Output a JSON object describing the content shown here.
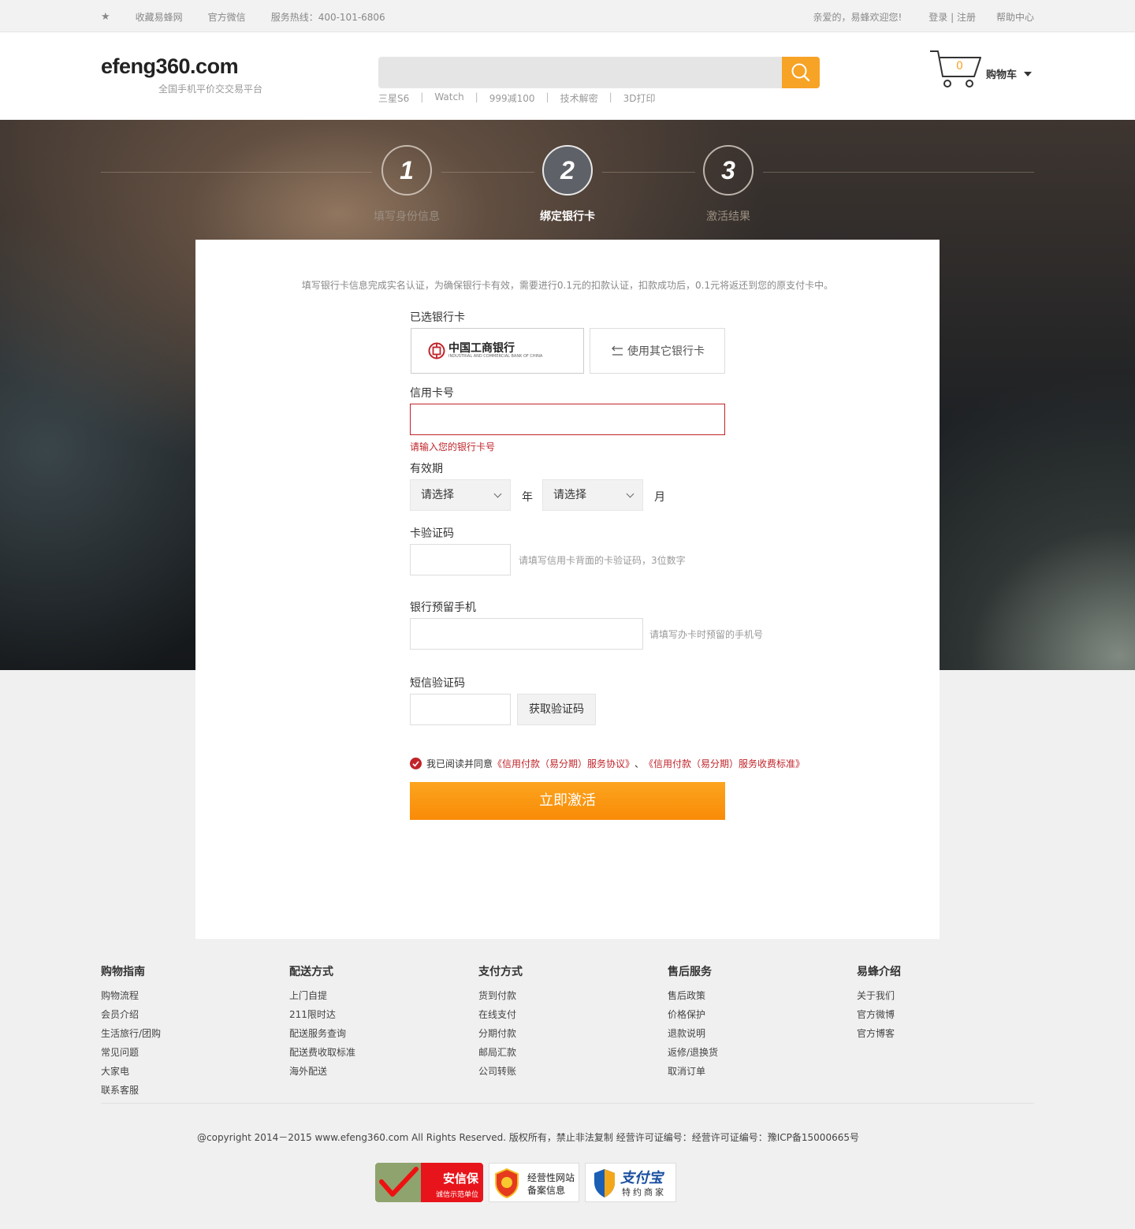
{
  "topbar": {
    "favorite": "收藏易蜂网",
    "wechat": "官方微信",
    "hotline": "服务热线：400-101-6806",
    "welcome": "亲爱的，易蜂欢迎您!",
    "login_register": "登录 | 注册",
    "help": "帮助中心"
  },
  "header": {
    "logo": "efeng360.com",
    "slogan": "全国手机平价交交易平台",
    "search_placeholder": "",
    "hotwords": [
      "三星S6",
      "Watch",
      "999减100",
      "技术解密",
      "3D打印"
    ],
    "cart_count": "0",
    "cart_label": "购物车"
  },
  "steps": [
    {
      "num": "1",
      "label": "填写身份信息"
    },
    {
      "num": "2",
      "label": "绑定银行卡"
    },
    {
      "num": "3",
      "label": "激活结果"
    }
  ],
  "form": {
    "intro": "填写银行卡信息完成实名认证，为确保银行卡有效，需要进行0.1元的扣款认证，扣款成功后，0.1元将返还到您的原支付卡中。",
    "selected_card_label": "已选银行卡",
    "bank_name": "中国工商银行",
    "bank_name_en": "INDUSTRIAL AND COMMERCIAL BANK OF CHINA",
    "other_card": "使用其它银行卡",
    "card_no_label": "信用卡号",
    "card_no_error": "请输入您的银行卡号",
    "expiry_label": "有效期",
    "year_select": "请选择",
    "year_unit": "年",
    "month_select": "请选择",
    "month_unit": "月",
    "cvv_label": "卡验证码",
    "cvv_hint": "请填写信用卡背面的卡验证码，3位数字",
    "phone_label": "银行预留手机",
    "phone_hint": "请填写办卡时预留的手机号",
    "sms_label": "短信验证码",
    "sms_button": "获取验证码",
    "agree_prefix": "我已阅读并同意",
    "agree_link1": "《信用付款（易分期）服务协议》",
    "agree_sep": "、",
    "agree_link2": "《信用付款（易分期）服务收费标准》",
    "submit": "立即激活"
  },
  "footer": {
    "columns": [
      {
        "title": "购物指南",
        "links": [
          "购物流程",
          "会员介绍",
          "生活旅行/团购",
          "常见问题",
          "大家电",
          "联系客服"
        ]
      },
      {
        "title": "配送方式",
        "links": [
          "上门自提",
          "211限时达",
          "配送服务查询",
          "配送费收取标准",
          "海外配送"
        ]
      },
      {
        "title": "支付方式",
        "links": [
          "货到付款",
          "在线支付",
          "分期付款",
          "邮局汇款",
          "公司转账"
        ]
      },
      {
        "title": "售后服务",
        "links": [
          "售后政策",
          "价格保护",
          "退款说明",
          "返修/退换货",
          "取消订单"
        ]
      },
      {
        "title": "易蜂介绍",
        "links": [
          "关于我们",
          "官方微博",
          "官方博客"
        ]
      }
    ],
    "copyright": "@copyright 2014－2015 www.efeng360.com All Rights Reserved. 版权所有，禁止非法复制 经营许可证编号：经营许可证编号：豫ICP备15000665号",
    "badges": {
      "anxinbao_title": "安信保",
      "anxinbao_sub": "诚信示范单位",
      "beian_line1": "经营性网站",
      "beian_line2": "备案信息",
      "alipay_title": "支付宝",
      "alipay_sub": "特约商家"
    }
  },
  "colors": {
    "accent": "#f7a326",
    "error": "#c0242a",
    "submit": "#f98b07"
  }
}
